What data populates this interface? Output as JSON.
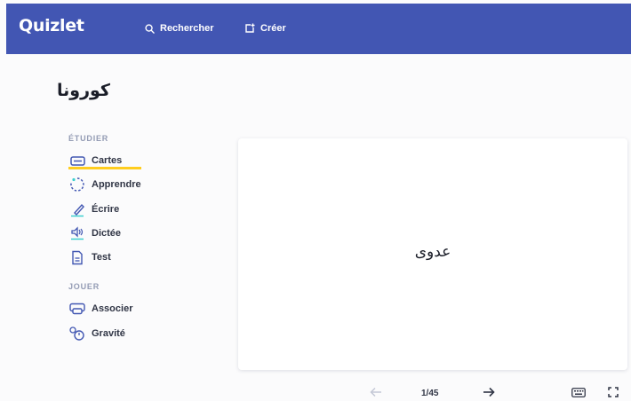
{
  "header": {
    "logo": "Quizlet",
    "search_label": "Rechercher",
    "create_label": "Créer"
  },
  "set": {
    "title": "كورونا"
  },
  "sidebar": {
    "study_heading": "ÉTUDIER",
    "study_modes": [
      {
        "label": "Cartes",
        "icon": "cards-icon",
        "active": true
      },
      {
        "label": "Apprendre",
        "icon": "learn-icon"
      },
      {
        "label": "Écrire",
        "icon": "write-icon"
      },
      {
        "label": "Dictée",
        "icon": "spell-icon"
      },
      {
        "label": "Test",
        "icon": "test-icon"
      }
    ],
    "play_heading": "JOUER",
    "play_modes": [
      {
        "label": "Associer",
        "icon": "match-icon"
      },
      {
        "label": "Gravité",
        "icon": "gravity-icon"
      }
    ]
  },
  "flashcard": {
    "term": "عدوى"
  },
  "controls": {
    "counter": "1/45",
    "prev_icon": "arrow-left-icon",
    "next_icon": "arrow-right-icon",
    "keyboard_icon": "keyboard-icon",
    "fullscreen_icon": "fullscreen-icon"
  },
  "colors": {
    "header_bg": "#4256b3",
    "active_underline": "#ffcd1f",
    "icon_accent": "#3ccfcf"
  }
}
